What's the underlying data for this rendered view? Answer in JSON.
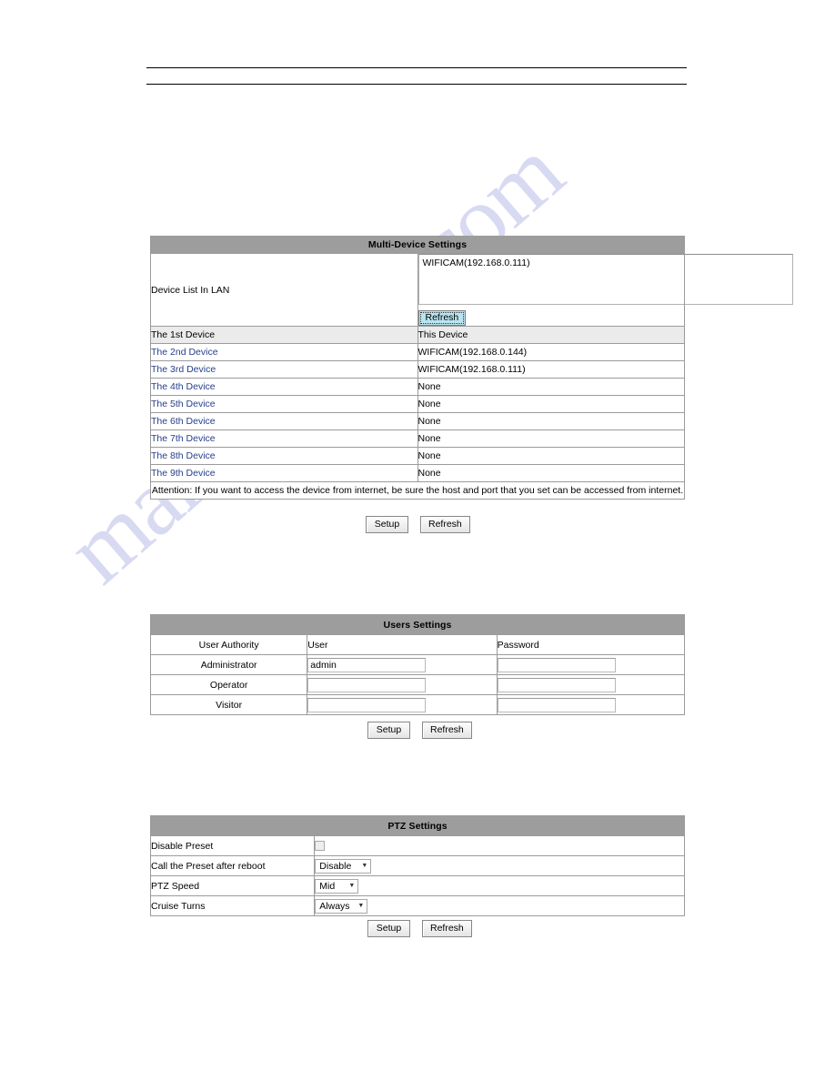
{
  "watermark": {
    "text": "manualslive.com"
  },
  "multi_device": {
    "title": "Multi-Device Settings",
    "device_list_label": "Device List In LAN",
    "lan_list_value": "WIFICAM(192.168.0.111)",
    "lan_refresh_label": "Refresh",
    "rows": [
      {
        "name": "The 1st Device",
        "value": "This Device",
        "is_link": false
      },
      {
        "name": "The 2nd Device",
        "value": "WIFICAM(192.168.0.144)",
        "is_link": true
      },
      {
        "name": "The 3rd Device",
        "value": "WIFICAM(192.168.0.111)",
        "is_link": true
      },
      {
        "name": "The 4th Device",
        "value": "None",
        "is_link": true
      },
      {
        "name": "The 5th Device",
        "value": "None",
        "is_link": true
      },
      {
        "name": "The 6th Device",
        "value": "None",
        "is_link": true
      },
      {
        "name": "The 7th Device",
        "value": "None",
        "is_link": true
      },
      {
        "name": "The 8th Device",
        "value": "None",
        "is_link": true
      },
      {
        "name": "The 9th Device",
        "value": "None",
        "is_link": true
      }
    ],
    "attention": "Attention: If you want to access the device from internet, be sure the host and port that you set can be accessed from internet.",
    "setup_label": "Setup",
    "refresh_label": "Refresh"
  },
  "users": {
    "title": "Users Settings",
    "header": {
      "authority": "User Authority",
      "user": "User",
      "password": "Password"
    },
    "rows": [
      {
        "authority": "Administrator",
        "user": "admin",
        "password": ""
      },
      {
        "authority": "Operator",
        "user": "",
        "password": ""
      },
      {
        "authority": "Visitor",
        "user": "",
        "password": ""
      }
    ],
    "setup_label": "Setup",
    "refresh_label": "Refresh"
  },
  "ptz": {
    "title": "PTZ Settings",
    "rows": [
      {
        "label": "Disable Preset",
        "control": "checkbox",
        "value": "",
        "checked": false
      },
      {
        "label": "Call the Preset after reboot",
        "control": "select",
        "value": "Disable"
      },
      {
        "label": "PTZ Speed",
        "control": "select",
        "value": "Mid"
      },
      {
        "label": "Cruise Turns",
        "control": "select",
        "value": "Always"
      }
    ],
    "setup_label": "Setup",
    "refresh_label": "Refresh"
  },
  "colors": {
    "title_bar": "#9d9d9d",
    "link": "#27408b",
    "first_row_bg": "#ebebeb",
    "watermark": "#b9bde8",
    "focus_button_bg": "#b9e4ef"
  }
}
